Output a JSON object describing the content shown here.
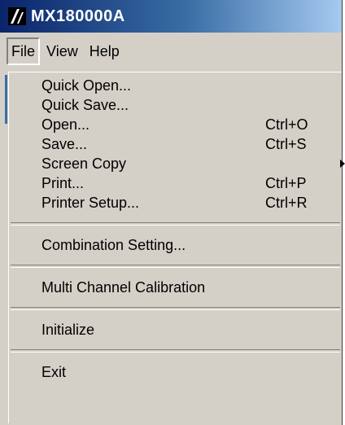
{
  "window": {
    "title": "MX180000A",
    "logo_icon": "anritsu-logo-icon"
  },
  "menubar": {
    "items": [
      {
        "label": "File",
        "active": true
      },
      {
        "label": "View",
        "active": false
      },
      {
        "label": "Help",
        "active": false
      }
    ]
  },
  "file_menu": {
    "items": [
      {
        "label": "Quick Open...",
        "shortcut": ""
      },
      {
        "label": "Quick Save...",
        "shortcut": ""
      },
      {
        "label": "Open...",
        "shortcut": "Ctrl+O"
      },
      {
        "label": "Save...",
        "shortcut": "Ctrl+S"
      },
      {
        "label": "Screen Copy",
        "shortcut": "",
        "has_submenu": true
      },
      {
        "label": "Print...",
        "shortcut": "Ctrl+P"
      },
      {
        "label": "Printer Setup...",
        "shortcut": "Ctrl+R"
      },
      {
        "label": "Combination Setting...",
        "shortcut": ""
      },
      {
        "label": "Multi Channel Calibration",
        "shortcut": ""
      },
      {
        "label": "Initialize",
        "shortcut": ""
      },
      {
        "label": "Exit",
        "shortcut": ""
      }
    ]
  },
  "colors": {
    "titlebar_start": "#0a246a",
    "titlebar_end": "#a6caf0",
    "menu_bg": "#d4d0c8"
  }
}
